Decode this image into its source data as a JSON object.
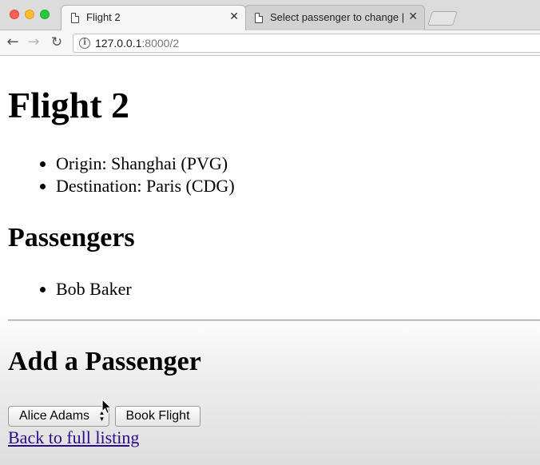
{
  "browser": {
    "tabs": [
      {
        "title": "Flight 2",
        "icon": "document-icon",
        "active": true
      },
      {
        "title": "Select passenger to change | D",
        "icon": "document-icon",
        "active": false
      }
    ],
    "url_host": "127.0.0.1",
    "url_path": ":8000/2",
    "icons": {
      "back": "←",
      "forward": "→",
      "reload": "↻",
      "info": "i",
      "close": "✕"
    }
  },
  "page": {
    "title": "Flight 2",
    "details": [
      "Origin: Shanghai (PVG)",
      "Destination: Paris (CDG)"
    ],
    "passengers_heading": "Passengers",
    "passengers": [
      "Bob Baker"
    ],
    "add_heading": "Add a Passenger",
    "select_value": "Alice Adams",
    "book_button": "Book Flight",
    "back_link": "Back to full listing"
  }
}
